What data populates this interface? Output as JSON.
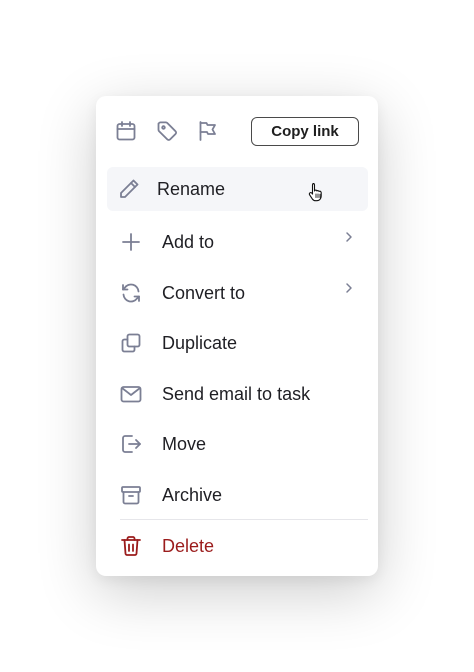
{
  "toolbar": {
    "icons": [
      "calendar-icon",
      "tag-icon",
      "flag-icon"
    ],
    "copy_link_label": "Copy link"
  },
  "menu": {
    "items": [
      {
        "label": "Rename",
        "icon": "pencil-icon",
        "state": "hovered"
      },
      {
        "label": "Add to",
        "icon": "plus-icon",
        "submenu": true
      },
      {
        "label": "Convert to",
        "icon": "convert-icon",
        "submenu": true
      },
      {
        "label": "Duplicate",
        "icon": "duplicate-icon"
      },
      {
        "label": "Send email to task",
        "icon": "email-icon"
      },
      {
        "label": "Move",
        "icon": "move-icon"
      },
      {
        "label": "Archive",
        "icon": "archive-icon"
      },
      {
        "label": "Delete",
        "icon": "trash-icon",
        "danger": true
      }
    ]
  },
  "colors": {
    "icon": "#7b7f94",
    "text": "#1f1f24",
    "danger": "#9b1c1c",
    "hover_bg": "#f5f6f9"
  }
}
